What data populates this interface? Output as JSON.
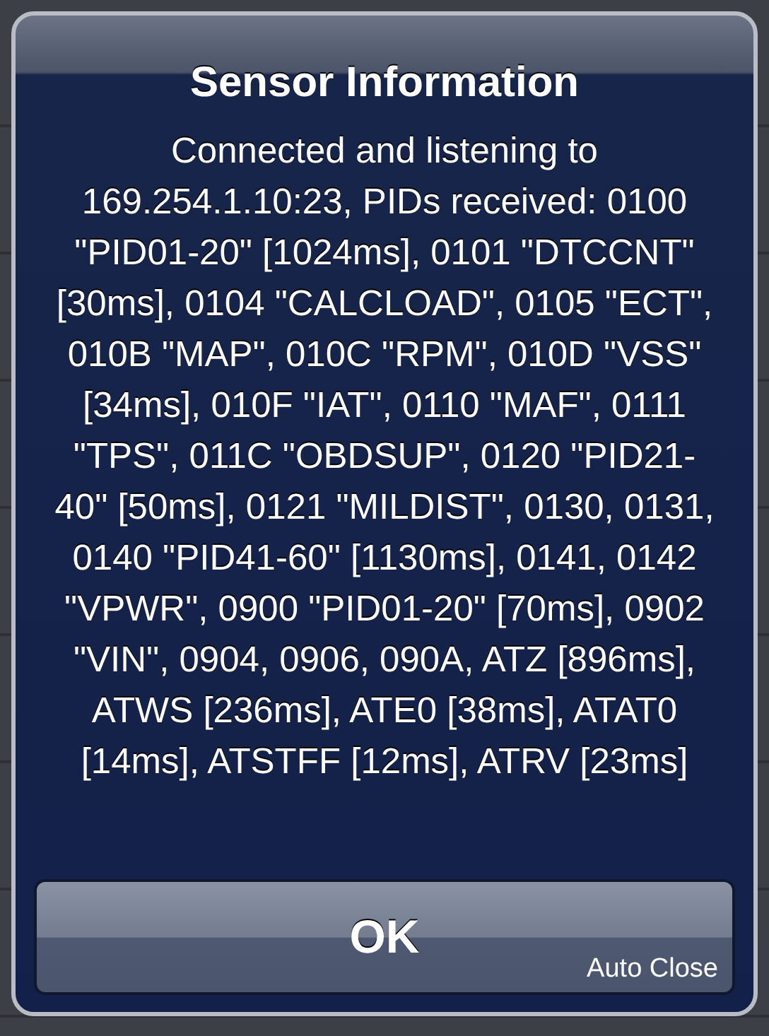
{
  "alert": {
    "title": "Sensor Information",
    "message": "Connected and listening to 169.254.1.10:23, PIDs received: 0100 \"PID01-20\" [1024ms], 0101 \"DTCCNT\" [30ms], 0104 \"CALCLOAD\", 0105 \"ECT\", 010B \"MAP\", 010C \"RPM\", 010D \"VSS\" [34ms], 010F \"IAT\", 0110 \"MAF\", 0111 \"TPS\", 011C \"OBDSUP\", 0120 \"PID21-40\" [50ms], 0121 \"MILDIST\", 0130, 0131, 0140 \"PID41-60\" [1130ms], 0141, 0142 \"VPWR\", 0900 \"PID01-20\" [70ms], 0902 \"VIN\", 0904, 0906, 090A, ATZ [896ms], ATWS [236ms], ATE0 [38ms], ATAT0 [14ms], ATSTFF [12ms], ATRV [23ms]",
    "button": {
      "label": "OK",
      "caption": "Auto Close"
    }
  }
}
